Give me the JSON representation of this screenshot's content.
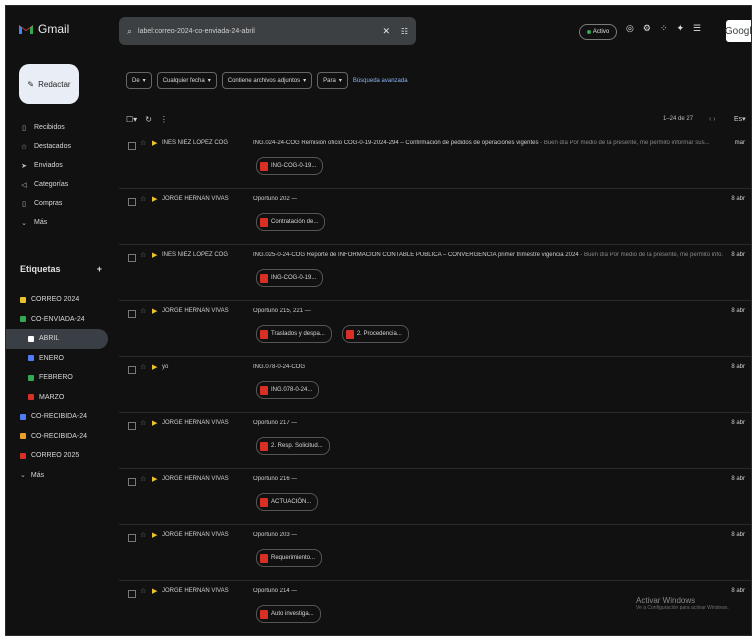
{
  "app": {
    "name": "Gmail"
  },
  "compose": {
    "label": "Redactar"
  },
  "nav": [
    {
      "icon": "inbox-icon",
      "glyph": "▯",
      "label": "Recibidos"
    },
    {
      "icon": "star-icon",
      "glyph": "☆",
      "label": "Destacados"
    },
    {
      "icon": "send-icon",
      "glyph": "➤",
      "label": "Enviados"
    },
    {
      "icon": "categories-icon",
      "glyph": "◁",
      "label": "Categorías"
    },
    {
      "icon": "shopping-icon",
      "glyph": "▯",
      "label": "Compras"
    },
    {
      "icon": "chevron-down-icon",
      "glyph": "⌄",
      "label": "Más"
    }
  ],
  "labels_section": {
    "title": "Etiquetas",
    "add_glyph": "+"
  },
  "labels": [
    {
      "name": "CORREO 2024",
      "color": "#e8c32b",
      "indent": 0,
      "active": false
    },
    {
      "name": "CO-ENVIADA-24",
      "color": "#34a853",
      "indent": 0,
      "active": false
    },
    {
      "name": "ABRIL",
      "color": "#ffffff",
      "indent": 1,
      "active": true
    },
    {
      "name": "ENERO",
      "color": "#4f7cf7",
      "indent": 1,
      "active": false
    },
    {
      "name": "FEBRERO",
      "color": "#34a853",
      "indent": 1,
      "active": false
    },
    {
      "name": "MARZO",
      "color": "#d93025",
      "indent": 1,
      "active": false
    },
    {
      "name": "CO-RECIBIDA-24",
      "color": "#4f7cf7",
      "indent": 0,
      "active": false
    },
    {
      "name": "CO-RECIBIDA-24",
      "color": "#e8a02b",
      "indent": 0,
      "active": false
    },
    {
      "name": "CORREO 2025",
      "color": "#d93025",
      "indent": 0,
      "active": false
    },
    {
      "name": "Más",
      "color": "",
      "indent": 0,
      "active": false
    }
  ],
  "search": {
    "value": "label:correo-2024-co-enviada-24-abril",
    "clear_glyph": "✕",
    "tune_glyph": "☷"
  },
  "topbar": {
    "status": "Activo",
    "icons": [
      "◎",
      "⚙",
      "⁘",
      "✦",
      "☰"
    ],
    "google": "Google"
  },
  "filters": {
    "chips": [
      "De",
      "Cualquier fecha",
      "Contiene archivos adjuntos",
      "Para"
    ],
    "advanced": "Búsqueda avanzada"
  },
  "toolbar": {
    "count": "1–24 de 27",
    "sort": "Es"
  },
  "emails": [
    {
      "sender": "INES NIEZ LOPEZ COG",
      "subject": "ING.024-24-COG Remisión oficio COG-0-19-2024-294 – Confirmación de pedidos de operaciones vigentes",
      "snippet": " - Buen día Por medio de la presente, me permito informar sus...",
      "date": "mar",
      "attachments": [
        "ING-COG-0-19..."
      ]
    },
    {
      "sender": "JORGE HERNAN VIVAS",
      "subject": "Oportuno 202 —",
      "snippet": "",
      "date": "8 abr",
      "attachments": [
        "Contratación de..."
      ]
    },
    {
      "sender": "INES NIEZ LOPEZ COG",
      "subject": "ING.025-0-24-COG Reporte de INFORMACIÓN CONTABLE PÚBLICA – CONVERGENCIA primer trimestre vigencia 2024",
      "snippet": " - Buen día Por medio de la presente, me permito info...",
      "date": "8 abr",
      "attachments": [
        "ING-COG-0-19..."
      ]
    },
    {
      "sender": "JORGE HERNAN VIVAS",
      "subject": "Oportuno 215, 221 —",
      "snippet": "",
      "date": "8 abr",
      "attachments": [
        "Traslados y despa...",
        "2. Procedencia..."
      ]
    },
    {
      "sender": "yo",
      "subject": "ING.078-0-24-COG",
      "snippet": "",
      "date": "8 abr",
      "attachments": [
        "ING.078-0-24..."
      ]
    },
    {
      "sender": "JORGE HERNAN VIVAS",
      "subject": "Oportuno 217 —",
      "snippet": "",
      "date": "8 abr",
      "attachments": [
        "2. Resp. Solicitud..."
      ]
    },
    {
      "sender": "JORGE HERNAN VIVAS",
      "subject": "Oportuno 216 —",
      "snippet": "",
      "date": "8 abr",
      "attachments": [
        "ACTUACIÓN..."
      ]
    },
    {
      "sender": "JORGE HERNAN VIVAS",
      "subject": "Oportuno 203 —",
      "snippet": "",
      "date": "8 abr",
      "attachments": [
        "Requerimiento..."
      ]
    },
    {
      "sender": "JORGE HERNAN VIVAS",
      "subject": "Oportuno 214 —",
      "snippet": "",
      "date": "8 abr",
      "attachments": [
        "Auto investiga..."
      ]
    }
  ],
  "watermark": {
    "line1": "Activar Windows",
    "line2": "Ve a Configuración para activar Windows."
  }
}
